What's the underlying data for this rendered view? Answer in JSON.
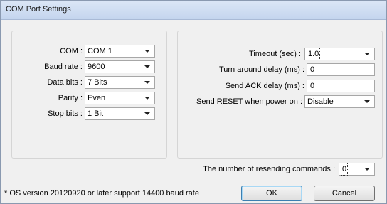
{
  "window": {
    "title": "COM Port Settings"
  },
  "left": {
    "com": {
      "label": "COM :",
      "value": "COM 1"
    },
    "baud": {
      "label": "Baud rate :",
      "value": "9600"
    },
    "data": {
      "label": "Data bits :",
      "value": "7 Bits"
    },
    "parity": {
      "label": "Parity :",
      "value": "Even"
    },
    "stop": {
      "label": "Stop bits :",
      "value": "1 Bit"
    }
  },
  "right": {
    "timeout": {
      "label": "Timeout (sec) :",
      "value": "1.0"
    },
    "turnaround": {
      "label": "Turn around delay (ms) :",
      "value": "0"
    },
    "ack": {
      "label": "Send ACK delay (ms) :",
      "value": "0"
    },
    "reset": {
      "label": "Send RESET when power on :",
      "value": "Disable"
    }
  },
  "resend": {
    "label": "The number of resending commands :",
    "value": "0"
  },
  "footnote": "* OS version 20120920 or later support 14400 baud rate",
  "buttons": {
    "ok": "OK",
    "cancel": "Cancel"
  }
}
